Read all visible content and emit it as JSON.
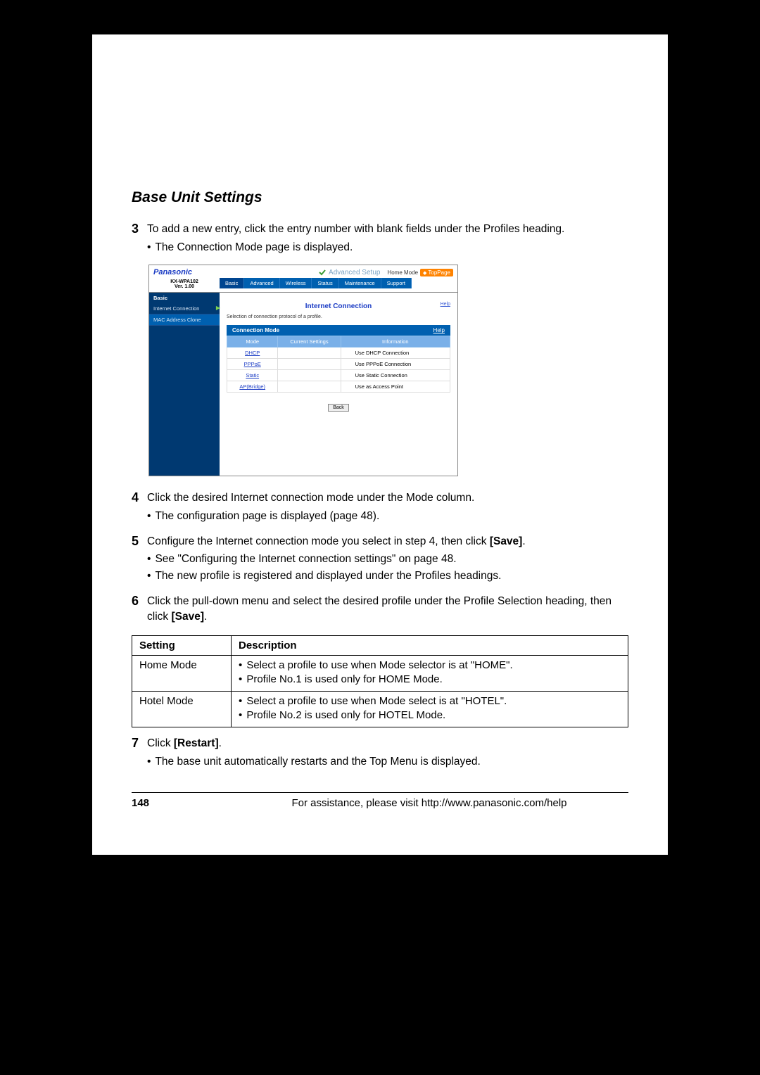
{
  "section_title": "Base Unit Settings",
  "steps": {
    "s3": {
      "num": "3",
      "text": "To add a new entry, click the entry number with blank fields under the Profiles heading.",
      "bullets": [
        "The Connection Mode page is displayed."
      ]
    },
    "s4": {
      "num": "4",
      "text": "Click the desired Internet connection mode under the Mode column.",
      "bullets": [
        "The configuration page is displayed (page 48)."
      ]
    },
    "s5": {
      "num": "5",
      "text_a": "Configure the Internet connection mode you select in step 4, then click ",
      "text_b": "[Save]",
      "text_c": ".",
      "bullets": [
        "See \"Configuring the Internet connection settings\" on page 48.",
        "The new profile is registered and displayed under the Profiles headings."
      ]
    },
    "s6": {
      "num": "6",
      "text_a": "Click the pull-down menu and select the desired profile under the Profile Selection heading, then click ",
      "text_b": "[Save]",
      "text_c": "."
    },
    "s7": {
      "num": "7",
      "text_a": "Click ",
      "text_b": "[Restart]",
      "text_c": ".",
      "bullets": [
        "The base unit automatically restarts and the Top Menu is displayed."
      ]
    }
  },
  "screenshot": {
    "logo": "Panasonic",
    "model": "KX-WPA102",
    "version": "Ver. 1.00",
    "advanced_setup": "Advanced Setup",
    "home_mode": "Home Mode",
    "top_page": "TopPage",
    "side_head": "Basic",
    "side_items": [
      "Internet Connection",
      "MAC Address Clone"
    ],
    "tabs": [
      "Basic",
      "Advanced",
      "Wireless",
      "Status",
      "Maintenance",
      "Support"
    ],
    "title": "Internet Connection",
    "help": "Help",
    "subtitle": "Selection of connection protocol of a profile.",
    "band_title": "Connection Mode",
    "band_help": "Help",
    "th": [
      "Mode",
      "Current Settings",
      "Information"
    ],
    "rows": [
      {
        "mode": "DHCP",
        "cur": "",
        "info": "Use DHCP Connection"
      },
      {
        "mode": "PPPoE",
        "cur": "",
        "info": "Use PPPoE Connection"
      },
      {
        "mode": "Static",
        "cur": "",
        "info": "Use Static Connection"
      },
      {
        "mode": "AP(Bridge)",
        "cur": "",
        "info": "Use as Access Point"
      }
    ],
    "back": "Back"
  },
  "settings_table": {
    "headers": [
      "Setting",
      "Description"
    ],
    "rows": [
      {
        "setting": "Home Mode",
        "desc": [
          "Select a profile to use when Mode selector is at \"HOME\".",
          "Profile No.1 is used only for HOME Mode."
        ]
      },
      {
        "setting": "Hotel Mode",
        "desc": [
          "Select a profile to use when Mode select is at \"HOTEL\".",
          "Profile No.2 is used only for HOTEL Mode."
        ]
      }
    ]
  },
  "footer": {
    "page": "148",
    "assist": "For assistance, please visit http://www.panasonic.com/help"
  }
}
